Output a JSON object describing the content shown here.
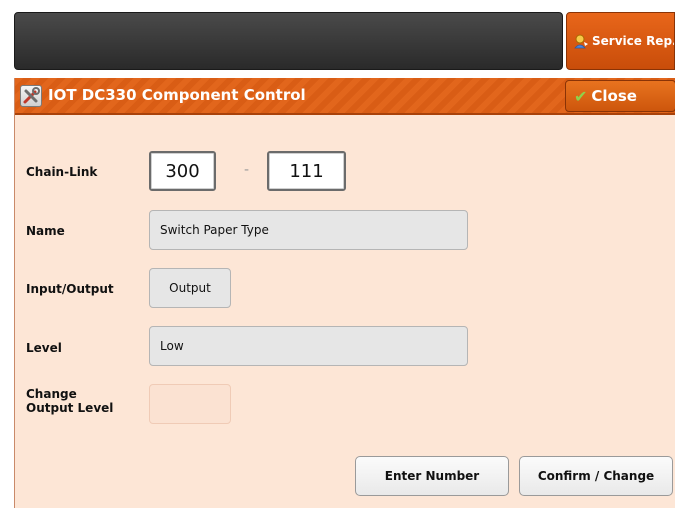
{
  "topbar": {
    "service_label": "Service Rep."
  },
  "dialog": {
    "title": "IOT DC330 Component Control",
    "close_label": "Close",
    "fields": {
      "chain_link_label": "Chain-Link",
      "chain_value": "300",
      "link_value": "111",
      "separator": "-",
      "name_label": "Name",
      "name_value": "Switch Paper Type",
      "io_label": "Input/Output",
      "io_value": "Output",
      "level_label": "Level",
      "level_value": "Low",
      "change_label_line1": "Change",
      "change_label_line2": "Output Level",
      "change_value": ""
    },
    "buttons": {
      "enter_number": "Enter Number",
      "confirm_change": "Confirm / Change"
    }
  },
  "colors": {
    "accent": "#e2661c",
    "dialog_background": "#fde6d6",
    "field_background": "#e6e6e6"
  },
  "icons": {
    "service": "service-rep-icon",
    "title": "tools-icon",
    "close": "checkmark-icon"
  }
}
